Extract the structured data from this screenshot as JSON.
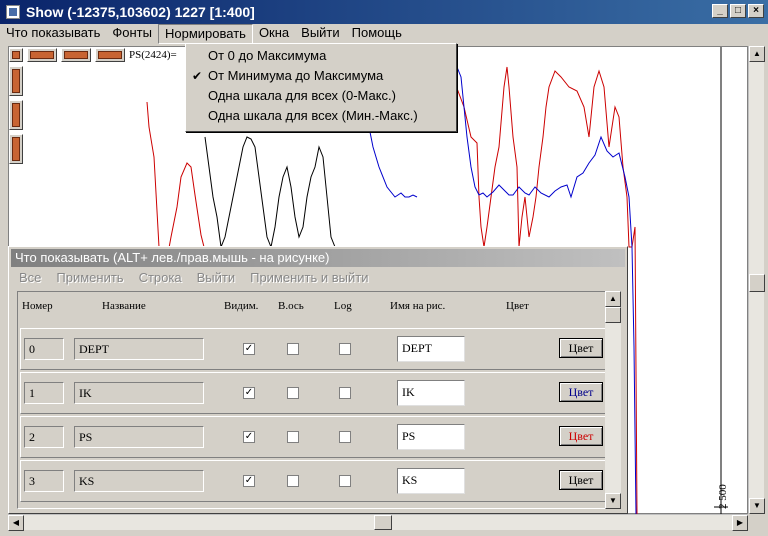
{
  "window": {
    "title": "Show (-12375,103602) 1227 [1:400]",
    "min": "_",
    "max": "□",
    "close": "×"
  },
  "menu": [
    "Что показывать",
    "Фонты",
    "Нормировать",
    "Окна",
    "Выйти",
    "Помощь"
  ],
  "dropdown": {
    "options": [
      {
        "label": "От 0 до Максимума",
        "checked": false
      },
      {
        "label": "От Минимума до Максимума",
        "checked": true
      },
      {
        "label": "Одна шкала для всех (0-Макс.)",
        "checked": false
      },
      {
        "label": "Одна шкала для всех (Мин.-Макс.)",
        "checked": false
      }
    ],
    "check_glyph": "✔"
  },
  "plot": {
    "ps_label": "PS(2424)=",
    "axis_label": "2 500"
  },
  "dialog": {
    "title": "Что показывать (ALT+ лев./прав.мышь - на рисунке)",
    "menu": [
      "Все",
      "Применить",
      "Строка",
      "Выйти",
      "Применить и выйти"
    ],
    "headers": {
      "num": "Номер",
      "name": "Название",
      "visible": "Видим.",
      "vaxis": "В.ось",
      "log": "Log",
      "picname": "Имя на рис.",
      "color": "Цвет"
    },
    "check_glyph": "✓",
    "rows": [
      {
        "num": "0",
        "name": "DEPT",
        "visible": true,
        "vaxis": false,
        "log": false,
        "picname": "DEPT",
        "color_label": "Цвет",
        "color": "#000000"
      },
      {
        "num": "1",
        "name": "IK",
        "visible": true,
        "vaxis": false,
        "log": false,
        "picname": "IK",
        "color_label": "Цвет",
        "color": "#00008b"
      },
      {
        "num": "2",
        "name": "PS",
        "visible": true,
        "vaxis": false,
        "log": false,
        "picname": "PS",
        "color_label": "Цвет",
        "color": "#cc0000"
      },
      {
        "num": "3",
        "name": "KS",
        "visible": true,
        "vaxis": false,
        "log": false,
        "picname": "KS",
        "color_label": "Цвет",
        "color": "#000000"
      }
    ]
  },
  "colors": {
    "title_start": "#0a246a",
    "title_end": "#3a6ea5",
    "curve_red": "#cc0000",
    "curve_blue": "#0000cc",
    "curve_black": "#000000"
  }
}
